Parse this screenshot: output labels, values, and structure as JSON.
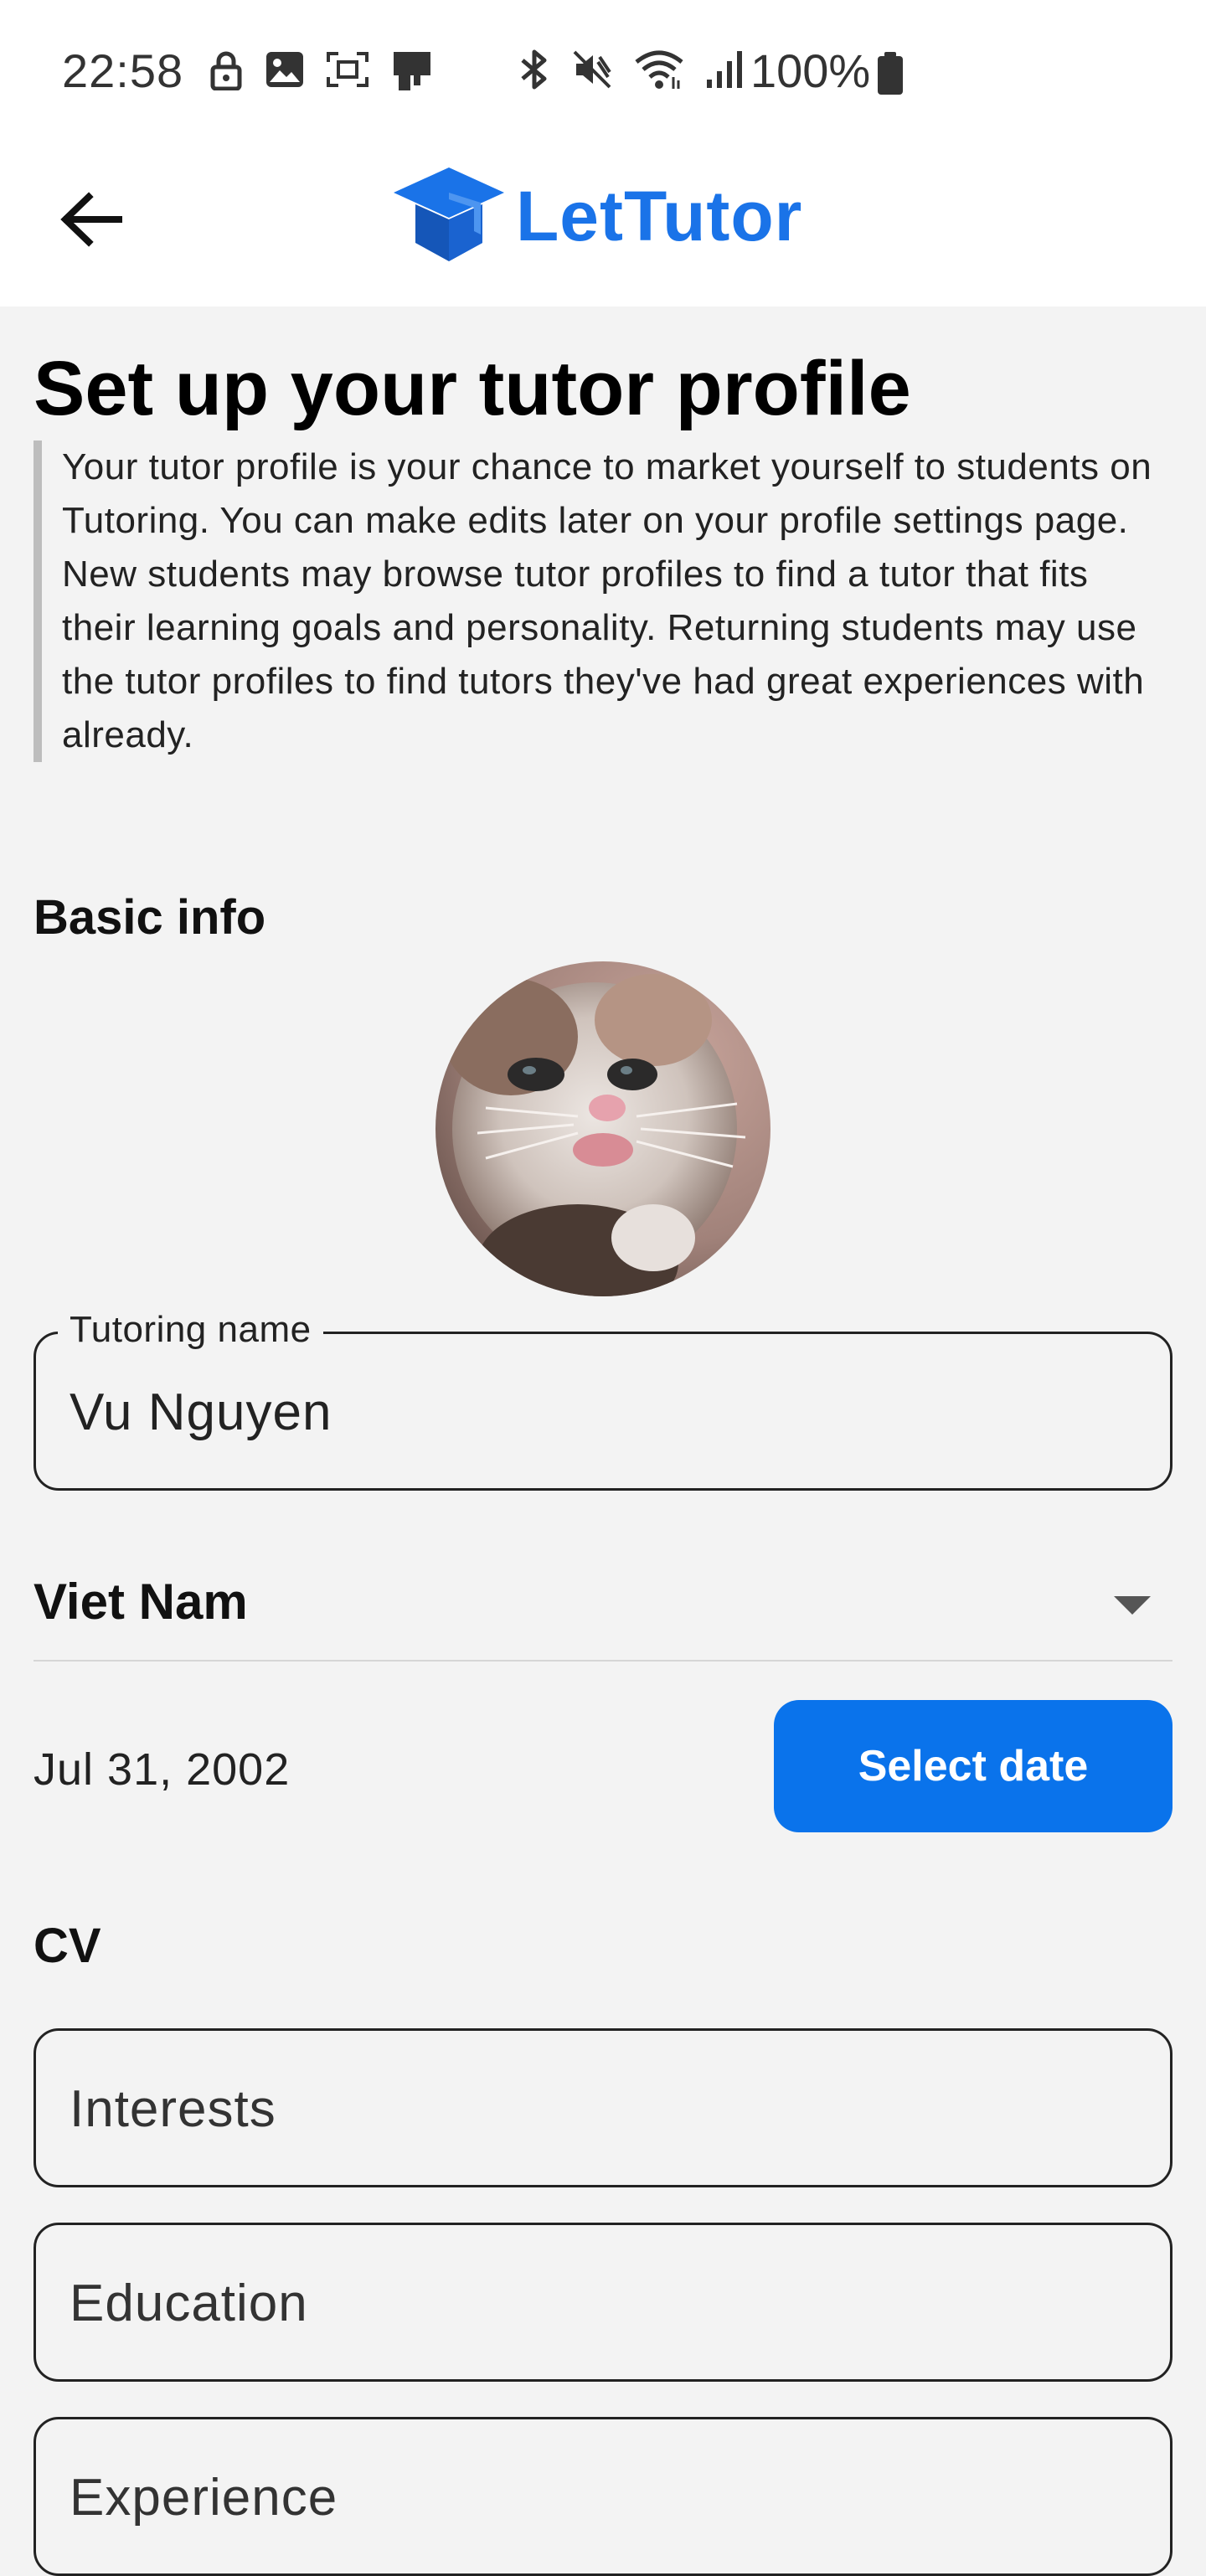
{
  "status_bar": {
    "time": "22:58",
    "left_icons": [
      "lock-icon",
      "image-icon",
      "screenshot-icon",
      "cast-icon"
    ],
    "right_icons": [
      "bluetooth-icon",
      "vibrate-mute-icon",
      "wifi-icon",
      "signal-icon"
    ],
    "battery": "100%"
  },
  "app_bar": {
    "brand": "LetTutor",
    "logo_icon": "graduation-cap-icon",
    "back_icon": "arrow-back-icon",
    "brand_color": "#1a73e8"
  },
  "page": {
    "title": "Set up your tutor profile",
    "intro_paragraph_1": "Your tutor profile is your chance to market yourself to students on Tutoring. You can make edits later on your profile settings page.",
    "intro_paragraph_2": "New students may browse tutor profiles to find a tutor that fits their learning goals and personality. Returning students may use the tutor profiles to find tutors they've had great experiences with already."
  },
  "basic_info": {
    "heading": "Basic info",
    "tutoring_name_label": "Tutoring name",
    "tutoring_name_value": "Vu Nguyen",
    "country": "Viet Nam",
    "date_of_birth": "Jul 31, 2002",
    "select_date_label": "Select date",
    "button_color": "#0a73eb"
  },
  "cv": {
    "heading": "CV",
    "fields": [
      {
        "placeholder": "Interests"
      },
      {
        "placeholder": "Education"
      },
      {
        "placeholder": "Experience"
      }
    ]
  }
}
